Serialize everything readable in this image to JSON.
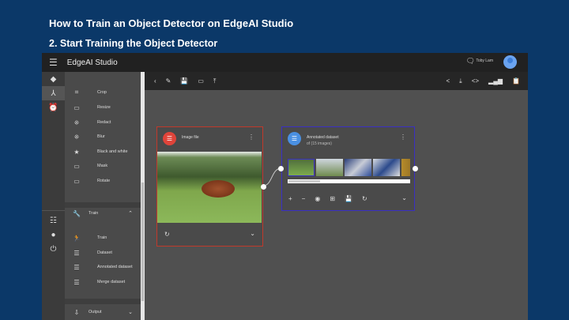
{
  "slide": {
    "title": "How to Train an Object Detector on EdgeAI Studio",
    "subtitle": "2. Start Training the Object Detector"
  },
  "app": {
    "title": "EdgeAI Studio",
    "user": "Toby Lam"
  },
  "panel": {
    "tools": [
      {
        "icon": "⌗",
        "label": "Crop"
      },
      {
        "icon": "▭",
        "label": "Resize"
      },
      {
        "icon": "⁜",
        "label": "Redact"
      },
      {
        "icon": "⁜",
        "label": "Blur"
      },
      {
        "icon": "★",
        "label": "Black and white"
      },
      {
        "icon": "▭",
        "label": "Mask"
      },
      {
        "icon": "▭",
        "label": "Rotate"
      }
    ],
    "train_section": "Train",
    "train_items": [
      {
        "icon": "🏃",
        "label": "Train"
      },
      {
        "icon": "☰",
        "label": "Dataset"
      },
      {
        "icon": "☰",
        "label": "Annotated dataset"
      },
      {
        "icon": "☰",
        "label": "Merge dataset"
      }
    ],
    "output_section": "Output"
  },
  "nodes": {
    "image": {
      "title": "Image file",
      "color": "#e0443a"
    },
    "dataset": {
      "title": "Annotated dataset",
      "subtitle": "of (15 images)",
      "color": "#4a90e2"
    }
  }
}
